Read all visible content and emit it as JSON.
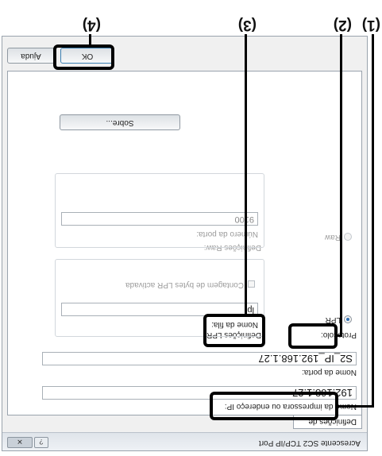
{
  "dialog": {
    "title": "Acrescente SC2 TCP/IP Port",
    "help": "?",
    "close": "✕"
  },
  "tab": {
    "label": "Definições de porta"
  },
  "fields": {
    "ip_label": "Nome da impressora ou endereço IP:",
    "ip_value": "192.168.1.27",
    "port_name_label": "Nome da porta:",
    "port_name_value": "S2_IP_192.168.1.27",
    "protocol_label": "Protocolo:",
    "lpr_option": "LPR",
    "raw_option": "Raw",
    "lpr_settings_label": "Definições LPR",
    "queue_label": "Nome da fila:",
    "queue_value": "lp",
    "byte_count_label": "Contagem de bytes LPR activada",
    "raw_settings_label": "Definições Raw:",
    "port_number_label": "Número da porta:",
    "port_number_value": "9100"
  },
  "buttons": {
    "about": "Sobre...",
    "ok": "OK",
    "help": "Ajuda"
  },
  "callouts": {
    "c1": "(1)",
    "c2": "(2)",
    "c3": "(3)",
    "c4": "(4)"
  }
}
